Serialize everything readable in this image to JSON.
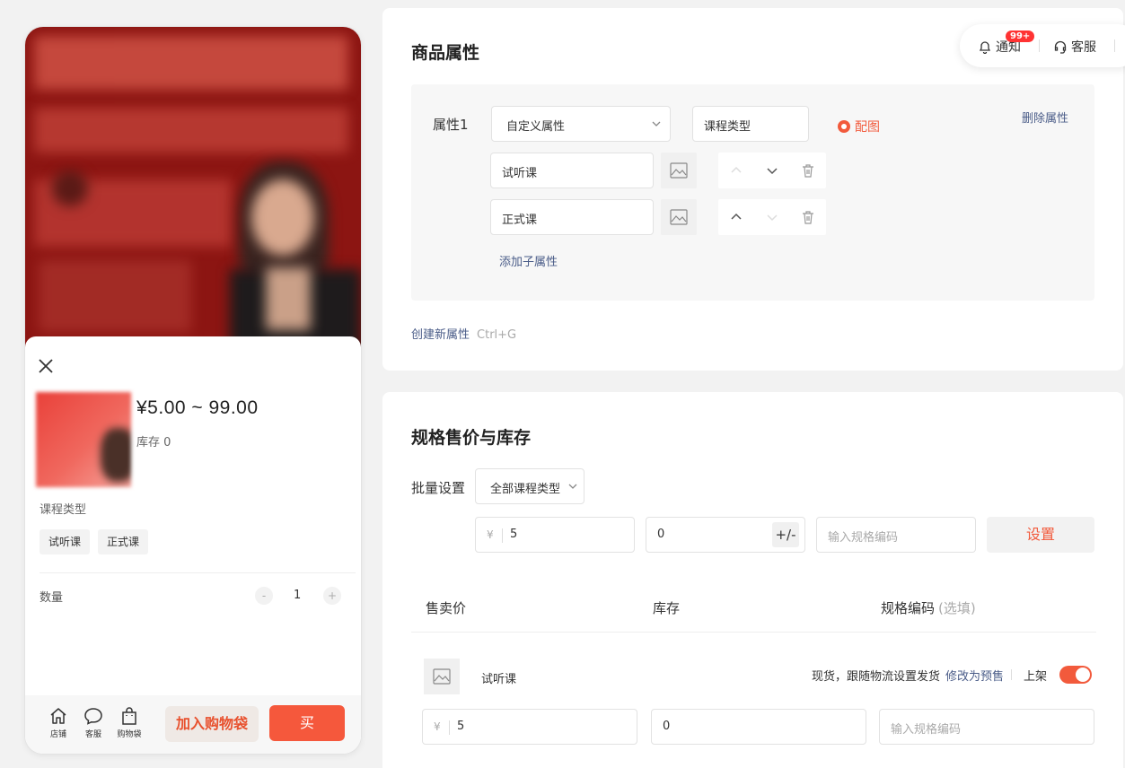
{
  "preview": {
    "price": "¥5.00 ~ 99.00",
    "stock": "库存 0",
    "spec_title": "课程类型",
    "options": [
      "试听课",
      "正式课"
    ],
    "qty_label": "数量",
    "qty_minus": "-",
    "qty_value": "1",
    "qty_plus": "+",
    "bottom": {
      "shop": "店铺",
      "service": "客服",
      "bag": "购物袋",
      "add_cart": "加入购物袋",
      "buy": "买"
    }
  },
  "topbar": {
    "notify_label": "通知",
    "notify_badge": "99+",
    "service_label": "客服"
  },
  "attributes": {
    "title": "商品属性",
    "attr_label": "属性1",
    "type_select": "自定义属性",
    "attr_name": "课程类型",
    "image_radio": "配图",
    "delete_link": "删除属性",
    "values": [
      "试听课",
      "正式课"
    ],
    "add_sub": "添加子属性",
    "create_new": "创建新属性",
    "create_shortcut": "Ctrl+G"
  },
  "pricing": {
    "title": "规格售价与库存",
    "batch_label": "批量设置",
    "batch_select": "全部课程类型",
    "currency": "¥",
    "batch_price": "5",
    "batch_stock": "0",
    "pm_symbol": "+/-",
    "code_placeholder": "输入规格编码",
    "set_button": "设置",
    "headers": {
      "price": "售卖价",
      "stock": "库存",
      "code": "规格编码",
      "code_optional": "(选填)"
    },
    "row": {
      "name": "试听课",
      "status": "现货，跟随物流设置发货",
      "presale_link": "修改为预售",
      "on_shelf": "上架",
      "on_shelf_enabled": true,
      "price": "5",
      "stock": "0",
      "code_placeholder": "输入规格编码"
    }
  },
  "colors": {
    "accent": "#f25a3c",
    "link": "#4a5c88",
    "banner": "#8c1512"
  }
}
